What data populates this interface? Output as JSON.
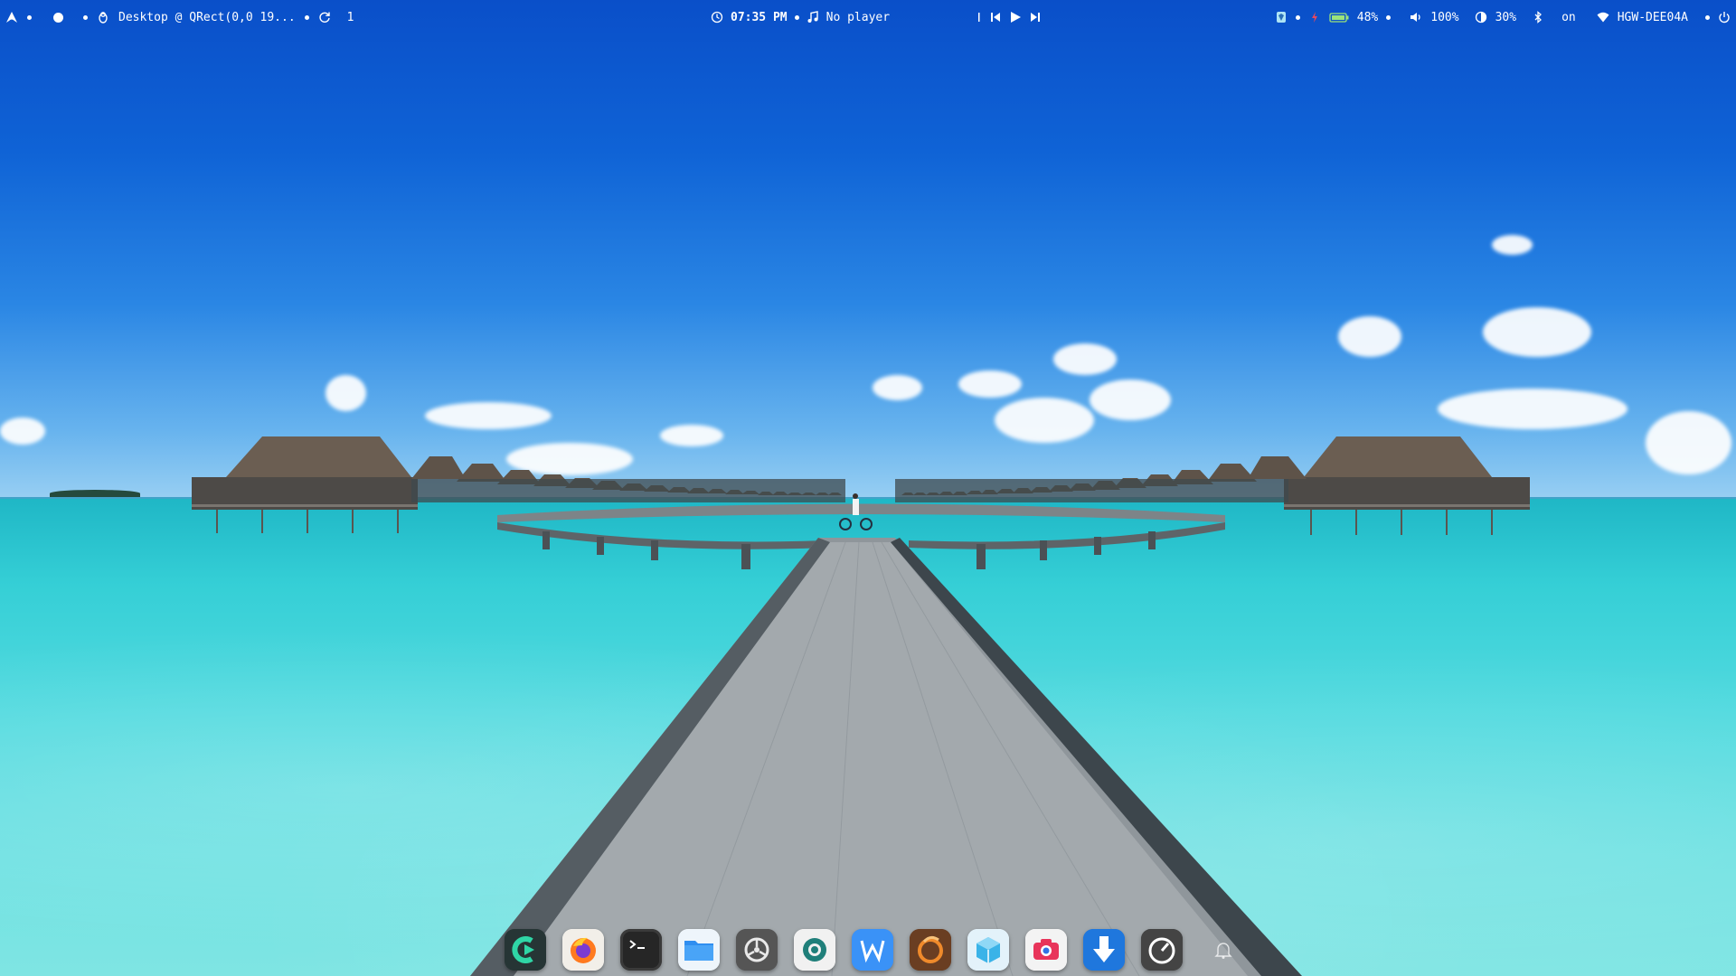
{
  "topbar": {
    "left": {
      "launcher_icon": "arch-logo-icon",
      "window_title": "Desktop @ QRect(0,0 19...",
      "workspace_count": "1"
    },
    "center": {
      "time": "07:35 PM",
      "player_status": "No player"
    },
    "right": {
      "battery_percent": "48%",
      "volume_percent": "100%",
      "brightness_percent": "30%",
      "bluetooth_status": "on",
      "wifi_network": "HGW-DEE04A"
    }
  },
  "dock": {
    "items": [
      {
        "name": "code-editor",
        "icon": "cursor-app-icon"
      },
      {
        "name": "firefox",
        "icon": "firefox-icon"
      },
      {
        "name": "terminal",
        "icon": "terminal-icon"
      },
      {
        "name": "files",
        "icon": "folder-icon"
      },
      {
        "name": "system-settings",
        "icon": "gear-icon"
      },
      {
        "name": "software-center",
        "icon": "gear-green-icon"
      },
      {
        "name": "writer",
        "icon": "w-icon"
      },
      {
        "name": "cleaner",
        "icon": "broom-icon"
      },
      {
        "name": "package-manager",
        "icon": "cube-icon"
      },
      {
        "name": "screenshot",
        "icon": "camera-icon"
      },
      {
        "name": "downloader",
        "icon": "download-icon"
      },
      {
        "name": "system-monitor",
        "icon": "gauge-icon"
      }
    ],
    "notifications_icon": "bell-icon"
  },
  "colors": {
    "sky_top": "#0a4fc9",
    "sea": "#52dadf",
    "bar_text": "#ffffff"
  }
}
